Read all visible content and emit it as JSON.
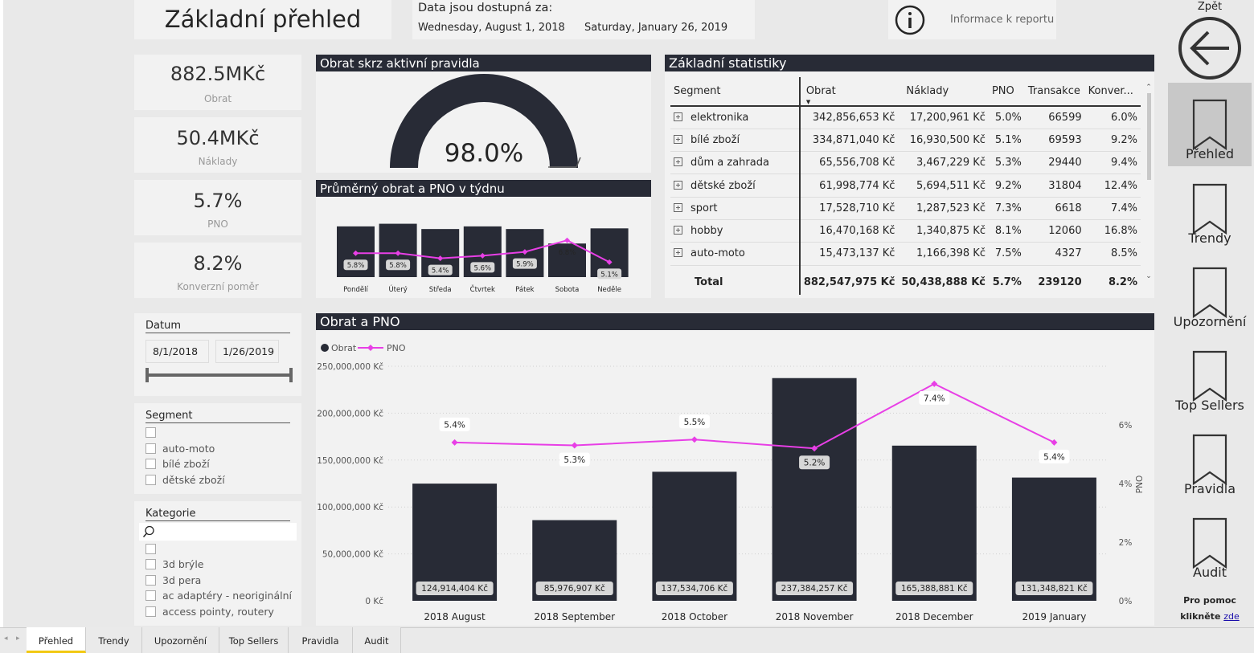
{
  "header": {
    "title": "Základní přehled",
    "availability_label": "Data jsou dostupná za:",
    "date_from": "Wednesday, August 1, 2018",
    "date_to": "Saturday, January 26, 2019",
    "info_label": "Informace k reportu"
  },
  "kpis": [
    {
      "value": "882.5MKč",
      "label": "Obrat"
    },
    {
      "value": "50.4MKč",
      "label": "Náklady"
    },
    {
      "value": "5.7%",
      "label": "PNO"
    },
    {
      "value": "8.2%",
      "label": "Konverzní poměr"
    }
  ],
  "gauge": {
    "title": "Obrat skrz aktivní pravidla",
    "value_label": "98.0%",
    "value": 0.98
  },
  "weekly": {
    "title": "Průměrný obrat a PNO v týdnu"
  },
  "stats": {
    "title": "Základní statistiky",
    "columns": [
      "Segment",
      "Obrat",
      "Náklady",
      "PNO",
      "Transakce",
      "Konver..."
    ],
    "rows": [
      [
        "elektronika",
        "342,856,653 Kč",
        "17,200,961 Kč",
        "5.0%",
        "66599",
        "6.0%"
      ],
      [
        "bílé zboží",
        "334,871,040 Kč",
        "16,930,500 Kč",
        "5.1%",
        "69593",
        "9.2%"
      ],
      [
        "dům a zahrada",
        "65,556,708 Kč",
        "3,467,229 Kč",
        "5.3%",
        "29440",
        "9.4%"
      ],
      [
        "dětské zboží",
        "61,998,774 Kč",
        "5,694,511 Kč",
        "9.2%",
        "31804",
        "12.4%"
      ],
      [
        "sport",
        "17,528,710 Kč",
        "1,287,523 Kč",
        "7.3%",
        "6618",
        "7.4%"
      ],
      [
        "hobby",
        "16,470,168 Kč",
        "1,340,875 Kč",
        "8.1%",
        "12060",
        "16.8%"
      ],
      [
        "auto-moto",
        "15,473,137 Kč",
        "1,166,398 Kč",
        "7.5%",
        "4327",
        "8.5%"
      ]
    ],
    "total": [
      "Total",
      "882,547,975 Kč",
      "50,438,888 Kč",
      "5.7%",
      "239120",
      "8.2%"
    ]
  },
  "slicers": {
    "datum": {
      "title": "Datum",
      "from": "8/1/2018",
      "to": "1/26/2019"
    },
    "segment": {
      "title": "Segment",
      "items": [
        "",
        "auto-moto",
        "bílé zboží",
        "dětské zboží"
      ]
    },
    "kategorie": {
      "title": "Kategorie",
      "search_placeholder": "",
      "items": [
        "",
        "3d brýle",
        "3d pera",
        "ac adaptéry - neoriginální",
        "access pointy, routery"
      ]
    }
  },
  "main_chart": {
    "title": "Obrat a PNO"
  },
  "nav": {
    "back_label": "Zpět",
    "items": [
      "Přehled",
      "Trendy",
      "Upozornění",
      "Top Sellers",
      "Pravidla",
      "Audit"
    ],
    "help_line1": "Pro pomoc",
    "help_line2": "klikněte",
    "help_link": "zde"
  },
  "tabs": [
    "Přehled",
    "Trendy",
    "Upozornění",
    "Top Sellers",
    "Pravidla",
    "Audit"
  ],
  "colors": {
    "bar": "#282b36",
    "line": "#e83fe6",
    "accent": "#f2c811"
  },
  "chart_data": [
    {
      "type": "bar",
      "categories": [
        "Pondělí",
        "Úterý",
        "Středa",
        "Čtvrtek",
        "Pátek",
        "Sobota",
        "Neděle"
      ],
      "series": [
        {
          "name": "Obrat",
          "values": [
            77,
            81,
            73,
            77,
            73,
            51,
            74
          ]
        },
        {
          "name": "PNO",
          "values": [
            5.8,
            5.8,
            5.4,
            5.6,
            5.9,
            6.8,
            5.1
          ],
          "labels": [
            "5.8%",
            "5.8%",
            "5.4%",
            "5.6%",
            "5.9%",
            "6.8%",
            "5.1%"
          ]
        }
      ],
      "ylim": [
        0,
        100
      ]
    },
    {
      "type": "bar",
      "categories": [
        "2018 August",
        "2018 September",
        "2018 October",
        "2018 November",
        "2018 December",
        "2019 January"
      ],
      "series": [
        {
          "name": "Obrat",
          "values": [
            124914404,
            85976907,
            137534706,
            237384257,
            165388881,
            131348821
          ],
          "labels": [
            "124,914,404 Kč",
            "85,976,907 Kč",
            "137,534,706 Kč",
            "237,384,257 Kč",
            "165,388,881 Kč",
            "131,348,821 Kč"
          ]
        },
        {
          "name": "PNO",
          "values": [
            5.4,
            5.3,
            5.5,
            5.2,
            7.4,
            5.4
          ],
          "labels": [
            "5.4%",
            "5.3%",
            "5.5%",
            "5.2%",
            "7.4%",
            "5.4%"
          ]
        }
      ],
      "y_ticks": [
        "0 Kč",
        "50,000,000 Kč",
        "100,000,000 Kč",
        "150,000,000 Kč",
        "200,000,000 Kč",
        "250,000,000 Kč"
      ],
      "y2_ticks": [
        "0%",
        "2%",
        "4%",
        "6%"
      ],
      "y2label": "PNO",
      "ylim": [
        0,
        250000000
      ],
      "y2lim": [
        0,
        8
      ],
      "legend": "top-left"
    }
  ]
}
